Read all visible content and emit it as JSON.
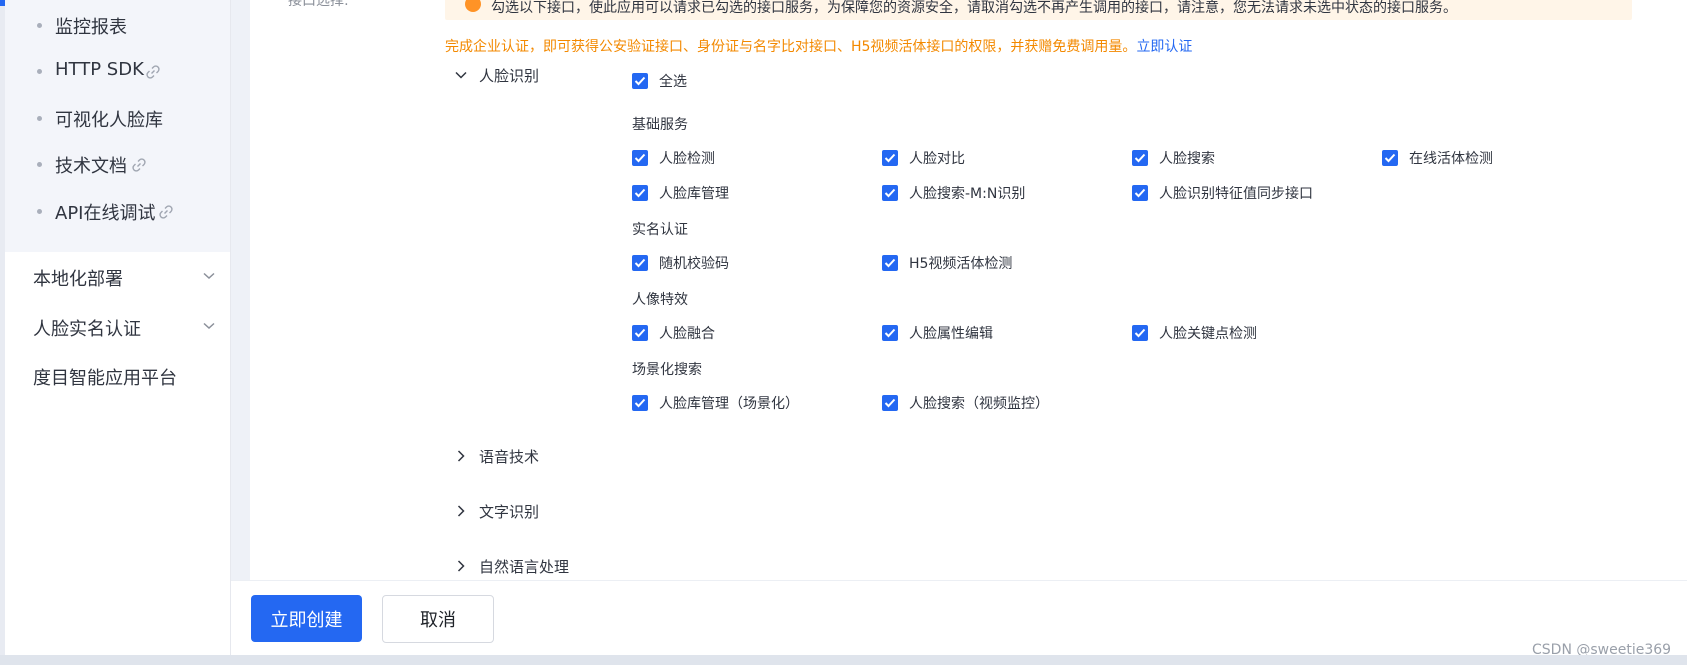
{
  "sidebar": {
    "sub_items": [
      {
        "label": "监控报表",
        "has_link": false
      },
      {
        "label": "HTTP SDK",
        "has_link": true
      },
      {
        "label": "可视化人脸库",
        "has_link": false
      },
      {
        "label": "技术文档",
        "has_link": true
      },
      {
        "label": "API在线调试",
        "has_link": true
      }
    ],
    "top_items": [
      {
        "label": "本地化部署",
        "expandable": true
      },
      {
        "label": "人脸实名认证",
        "expandable": true
      },
      {
        "label": "度目智能应用平台",
        "expandable": false
      }
    ]
  },
  "form": {
    "field_label_cut": "接口选择:",
    "notice_text": "勾选以下接口，使此应用可以请求已勾选的接口服务，为保障您的资源安全，请取消勾选不再产生调用的接口，请注意，您无法请求未选中状态的接口服务。",
    "cert_note": "完成企业认证，即可获得公安验证接口、身份证与名字比对接口、H5视频活体接口的权限，并获赠免费调用量。",
    "cert_link": "立即认证"
  },
  "face_section": {
    "title": "人脸识别",
    "expanded": true,
    "select_all": {
      "label": "全选",
      "checked": true
    },
    "groups": [
      {
        "title": "基础服务",
        "items": [
          {
            "label": "人脸检测",
            "checked": true
          },
          {
            "label": "人脸对比",
            "checked": true
          },
          {
            "label": "人脸搜索",
            "checked": true
          },
          {
            "label": "在线活体检测",
            "checked": true
          },
          {
            "label": "人脸库管理",
            "checked": true
          },
          {
            "label": "人脸搜索-M:N识别",
            "checked": true
          },
          {
            "label": "人脸识别特征值同步接口",
            "checked": true
          }
        ]
      },
      {
        "title": "实名认证",
        "items": [
          {
            "label": "随机校验码",
            "checked": true
          },
          {
            "label": "H5视频活体检测",
            "checked": true
          }
        ]
      },
      {
        "title": "人像特效",
        "items": [
          {
            "label": "人脸融合",
            "checked": true
          },
          {
            "label": "人脸属性编辑",
            "checked": true
          },
          {
            "label": "人脸关键点检测",
            "checked": true
          }
        ]
      },
      {
        "title": "场景化搜索",
        "items": [
          {
            "label": "人脸库管理（场景化）",
            "checked": true
          },
          {
            "label": "人脸搜索（视频监控）",
            "checked": true
          }
        ]
      }
    ]
  },
  "collapsed_sections": [
    {
      "title": "语音技术"
    },
    {
      "title": "文字识别"
    },
    {
      "title": "自然语言处理"
    }
  ],
  "footer": {
    "create_label": "立即创建",
    "cancel_label": "取消"
  },
  "watermark": "CSDN @sweetie369",
  "colors": {
    "primary": "#2468f2",
    "warning_text": "#f38900",
    "notice_bg": "#fff5e8"
  }
}
